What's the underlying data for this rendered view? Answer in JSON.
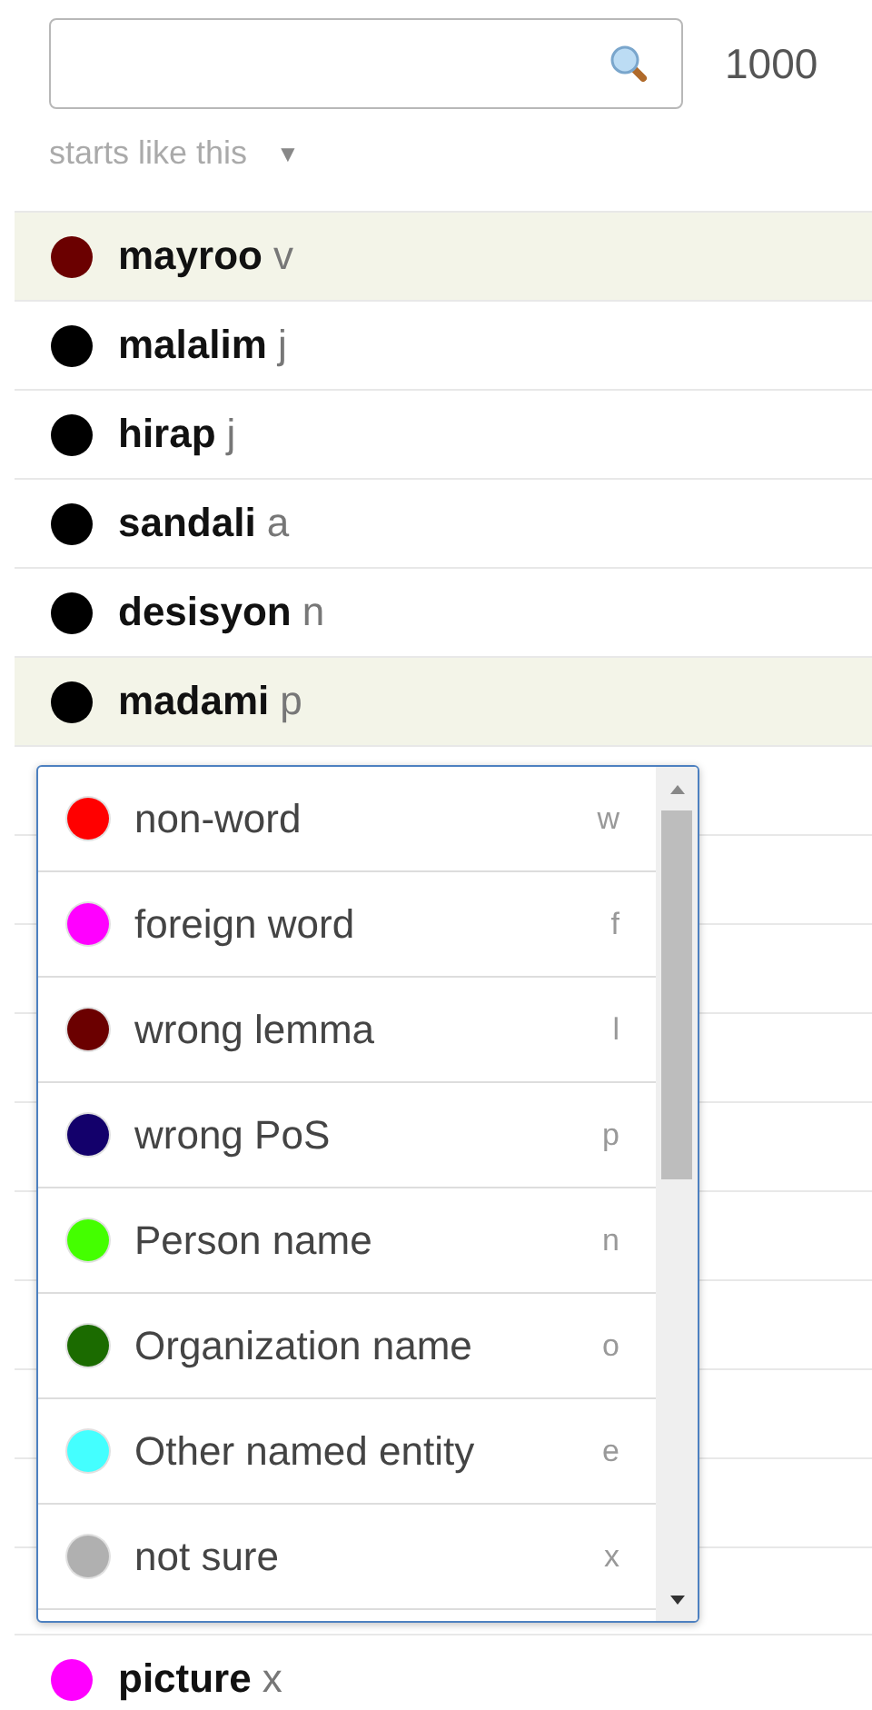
{
  "search": {
    "count": "1000",
    "mode": "starts like this",
    "mode_caret": "▼"
  },
  "words": [
    {
      "word": "mayroo",
      "pos": "v",
      "color": "#6b0000",
      "selected": true
    },
    {
      "word": "malalim",
      "pos": "j",
      "color": "#000000",
      "selected": false
    },
    {
      "word": "hirap",
      "pos": "j",
      "color": "#000000",
      "selected": false
    },
    {
      "word": "sandali",
      "pos": "a",
      "color": "#000000",
      "selected": false
    },
    {
      "word": "desisyon",
      "pos": "n",
      "color": "#000000",
      "selected": false
    },
    {
      "word": "madami",
      "pos": "p",
      "color": "#000000",
      "selected": true
    }
  ],
  "words_below": [
    {
      "word": "picture",
      "pos": "x",
      "color": "#ff00ff",
      "selected": false
    }
  ],
  "popup": {
    "items": [
      {
        "label": "non-word",
        "key": "w",
        "color": "#ff0000"
      },
      {
        "label": "foreign word",
        "key": "f",
        "color": "#ff00ff"
      },
      {
        "label": "wrong lemma",
        "key": "l",
        "color": "#6b0000"
      },
      {
        "label": "wrong PoS",
        "key": "p",
        "color": "#13006b"
      },
      {
        "label": "Person name",
        "key": "n",
        "color": "#44ff00"
      },
      {
        "label": "Organization name",
        "key": "o",
        "color": "#1b6b00"
      },
      {
        "label": "Other named entity",
        "key": "e",
        "color": "#44ffff"
      },
      {
        "label": "not sure",
        "key": "x",
        "color": "#b0b0b0"
      }
    ]
  }
}
